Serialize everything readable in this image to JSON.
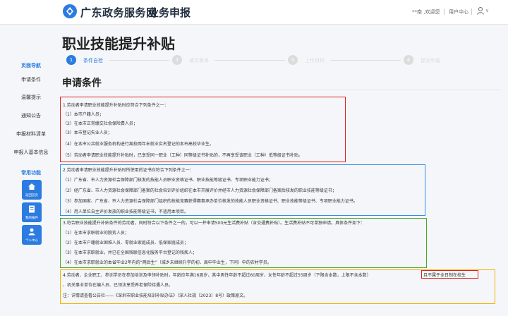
{
  "header": {
    "site_name": "广东政务服务网",
    "section_name": "业务申报",
    "welcome": "**南 ,欢迎您",
    "user_center": "用户中心",
    "caret": "∨"
  },
  "page_title": "职业技能提升补贴",
  "sidebar": {
    "nav_title": "页面导航",
    "nav_items": [
      "申请条件",
      "温馨提示",
      "通知公告",
      "申报材料清单",
      "申报人基本信息"
    ],
    "func_title": "常用功能",
    "quick_buttons": [
      "返回首页",
      "我的报件",
      "个人中心"
    ]
  },
  "steps": [
    {
      "num": "1",
      "label": "条件自检"
    },
    {
      "num": "2",
      "label": "填写表单"
    },
    {
      "num": "3",
      "label": "上传材料"
    },
    {
      "num": "4",
      "label": "提交申报"
    }
  ],
  "section_title": "申请条件",
  "conditions": {
    "group1": [
      "1.劳动者申请职业技能提升补贴时应符合下列条件之一：",
      "（1）本市户籍人员；",
      "（2）在本市正常缴交社会保险费人员；",
      "（3）本市登记失业人员；",
      "（4）在本市公共就业服务机构进行离校两年未就业实名登记的本市高校毕业生。",
      "（5）劳动者申请职业技能提升补贴时，已享受同一职业（工种）同等级证书补贴的，不再享受该职业（工种）低等级证书补贴。"
    ],
    "group2": [
      "2.劳动者申请职业技能提升补贴时所使用的证书应符合下列条件之一：",
      "（1）广东省、市人力资源社会保障部门核发的技能人员职业资格证书、职业技能等级证书、专项职业能力证书；",
      "（2）经广东省、市人力资源社会保障部门备案的社会培训评价组织在本市开展评价并经市人力资源社会保障部门备案后核发的职业技能等级证书；",
      "（3）参加国家、广东省、市人力资源社会保障部门组织的技能竞赛获得赛事承办单位核发的技能人员职业资格证书、职业技能等级证书、专项职业能力证书。",
      "（4）用人单位自主评价发放的职业技能等级证书，不适用本项目。"
    ],
    "group3": [
      "3.符合职业技能提升补贴条件的劳动者，同时符合以下条件之一的，可以一并申请500元生活费补贴（含交通费补贴）。生活费补贴不可单独申请。具体条件如下：",
      "（1）在本市求职就业的脱贫人员；",
      "（2）在本市户籍就业困难人员、零就业家庭成员、低保家庭成员；",
      "（3）在本市求职就业，并已在全国残联信息化服务平台登记的残疾人；",
      "（4）在本市求职就业的本省毕业2年内的“两后生”（城乡未继续升学的初、高中毕业生，下同）中的农村学员。"
    ],
    "group4": [
      "4.劳动者、企业职工、参训学员在参加培训及申领补贴时，年龄应年满16周岁，其中男性年龄不超过60周岁，女性年龄不超过55周岁（下限含本数，上限不含本数）",
      "且不属于全日制在校生",
      "、机关事业单位在编人员、已领法享受养老保险待遇人员。",
      "注：详情请查看公告栏——《深圳市职业技能培训补贴办法》（深人社规〔2023〕8号）政策原文。"
    ]
  },
  "colors": {
    "accent": "#2b7be0",
    "box_red": "#e02020",
    "box_blue": "#2f8fe8",
    "box_green": "#4aa832",
    "box_yellow": "#f0b400"
  }
}
